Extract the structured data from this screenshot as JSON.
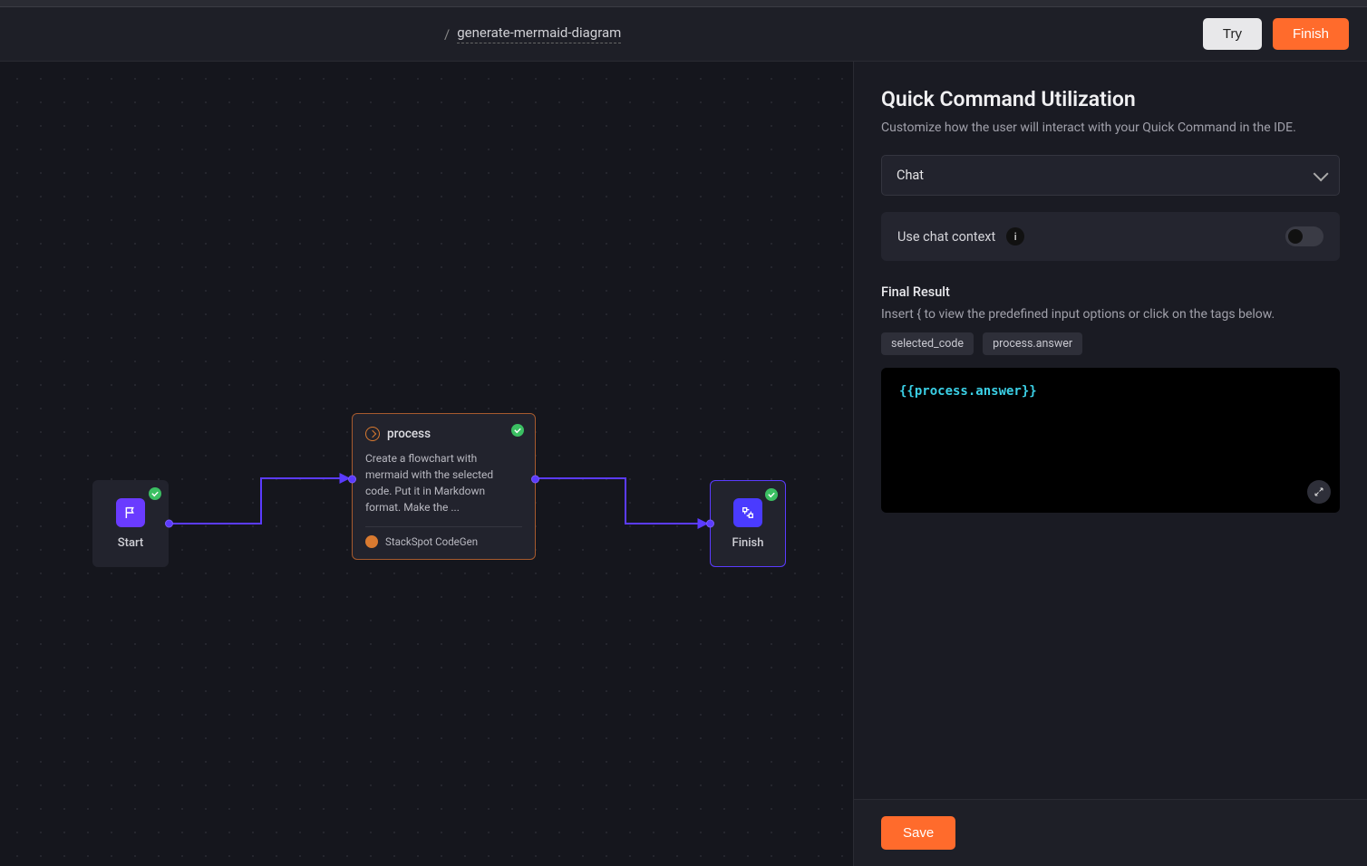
{
  "breadcrumb": {
    "slash": "/",
    "name": "generate-mermaid-diagram"
  },
  "header": {
    "try": "Try",
    "finish": "Finish"
  },
  "nodes": {
    "start": {
      "label": "Start"
    },
    "process": {
      "title": "process",
      "desc": "Create a flowchart with mermaid with the selected code. Put it in Markdown format. Make the ...",
      "codegen": "StackSpot CodeGen"
    },
    "finish": {
      "label": "Finish"
    }
  },
  "panel": {
    "title": "Quick Command Utilization",
    "desc": "Customize how the user will interact with your Quick Command in the IDE.",
    "mode": "Chat",
    "context_label": "Use chat context",
    "info_char": "i",
    "final_label": "Final Result",
    "final_hint": "Insert { to view the predefined input options or click on the tags below.",
    "tags": {
      "a": "selected_code",
      "b": "process.answer"
    },
    "code": "{{process.answer}}",
    "save": "Save"
  }
}
